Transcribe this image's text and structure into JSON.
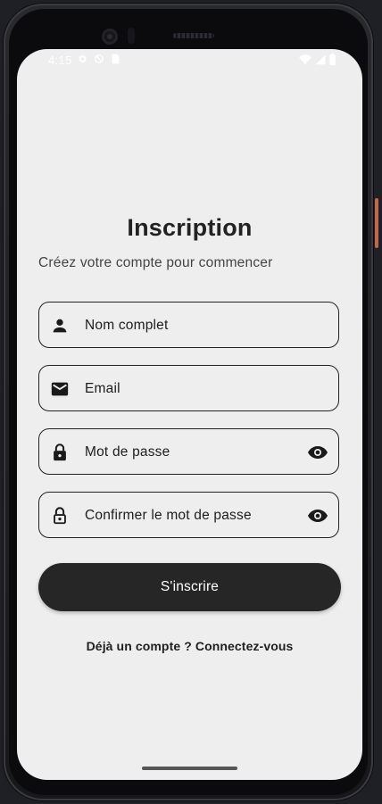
{
  "status_bar": {
    "time": "4:15",
    "left_icons": [
      "settings-icon",
      "blocked-icon",
      "sim-card-icon"
    ],
    "right_icons": [
      "wifi-icon",
      "signal-icon",
      "battery-icon"
    ]
  },
  "page": {
    "title": "Inscription",
    "subtitle": "Créez votre compte pour commencer"
  },
  "form": {
    "fields": [
      {
        "placeholder": "Nom complet",
        "icon": "person-icon"
      },
      {
        "placeholder": "Email",
        "icon": "mail-icon"
      },
      {
        "placeholder": "Mot de passe",
        "icon": "lock-filled-icon",
        "trailing_icon": "eye-icon"
      },
      {
        "placeholder": "Confirmer le mot de passe",
        "icon": "lock-outline-icon",
        "trailing_icon": "eye-icon"
      }
    ],
    "submit_label": "S'inscrire"
  },
  "footer": {
    "login_link": "Déjà un compte ? Connectez-vous"
  },
  "colors": {
    "background": "#eeeeee",
    "button": "#262626",
    "button_text": "#ffffff",
    "text": "#222222"
  }
}
